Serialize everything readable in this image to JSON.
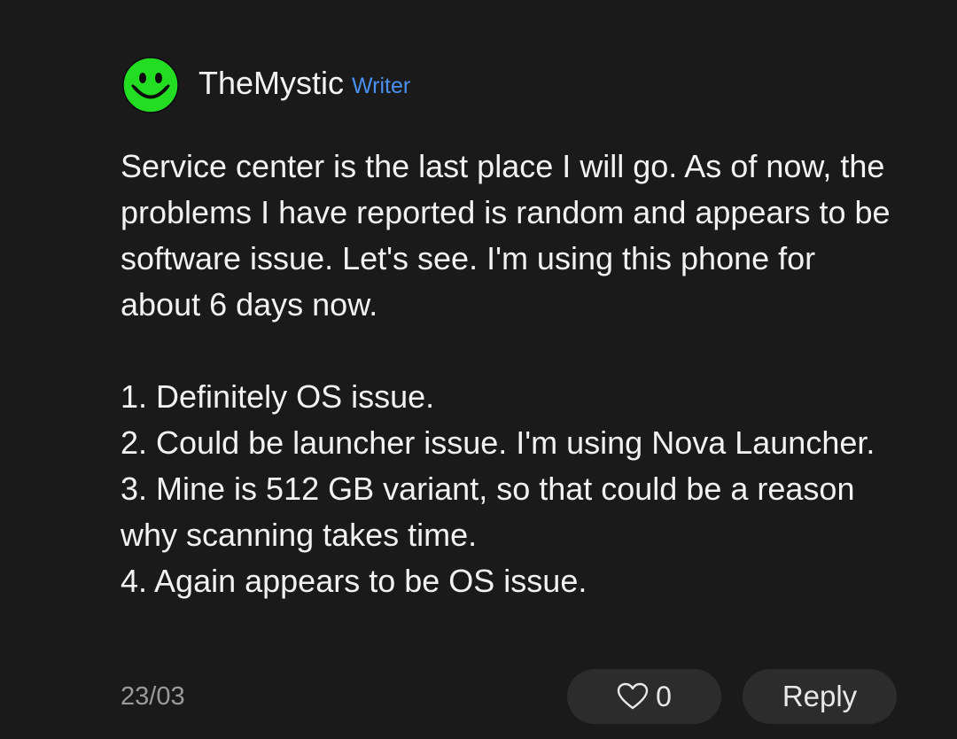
{
  "comment": {
    "author": {
      "name": "TheMystic",
      "role": "Writer",
      "avatar_icon": "smiley-face-icon",
      "avatar_color": "#22dd22"
    },
    "body": {
      "paragraph": "Service center is the last place I will go. As of now, the problems I have reported is random and appears to be software issue. Let's see. I'm using this phone for about 6 days now.",
      "points": [
        "1. Definitely OS issue.",
        "2. Could be launcher issue. I'm using Nova Launcher.",
        "3. Mine is 512 GB variant, so that could be a reason why scanning takes time.",
        "4. Again appears to be OS issue."
      ]
    },
    "footer": {
      "date": "23/03",
      "like_icon": "heart-outline-icon",
      "like_count": "0",
      "reply_label": "Reply"
    }
  },
  "colors": {
    "background": "#1a1a1a",
    "text": "#f2f2f2",
    "accent": "#4a90f0",
    "muted": "#9a9a9a",
    "button_bg": "#2c2c2c"
  }
}
